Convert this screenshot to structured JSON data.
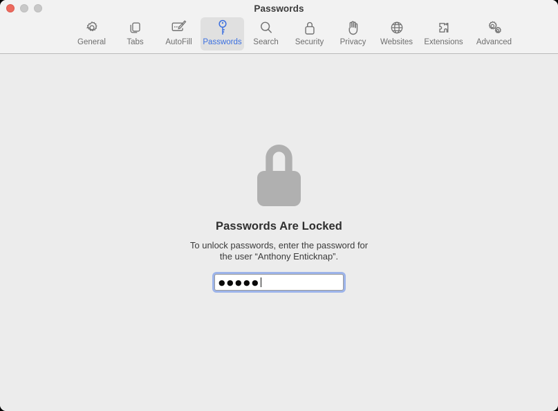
{
  "window": {
    "title": "Passwords",
    "traffic_lights": [
      {
        "name": "close",
        "color": "#ec6a5e"
      },
      {
        "name": "minimize",
        "color": "#c8c8c8"
      },
      {
        "name": "zoom",
        "color": "#c8c8c8"
      }
    ],
    "background": "#ececec",
    "toolbar_background": "#f2f2f2"
  },
  "toolbar": {
    "selected": "Passwords",
    "accent_color": "#3a6fe0",
    "items": [
      {
        "label": "General",
        "icon": "gear-icon",
        "selected": false
      },
      {
        "label": "Tabs",
        "icon": "tabs-icon",
        "selected": false
      },
      {
        "label": "AutoFill",
        "icon": "autofill-icon",
        "selected": false
      },
      {
        "label": "Passwords",
        "icon": "key-icon",
        "selected": true
      },
      {
        "label": "Search",
        "icon": "search-icon",
        "selected": false
      },
      {
        "label": "Security",
        "icon": "lock-icon",
        "selected": false
      },
      {
        "label": "Privacy",
        "icon": "hand-icon",
        "selected": false
      },
      {
        "label": "Websites",
        "icon": "globe-icon",
        "selected": false
      },
      {
        "label": "Extensions",
        "icon": "puzzle-icon",
        "selected": false
      },
      {
        "label": "Advanced",
        "icon": "gears-icon",
        "selected": false
      }
    ]
  },
  "main": {
    "status_icon": "padlock-closed-icon",
    "status_icon_color": "#b0b0b0",
    "title": "Passwords Are Locked",
    "description_line1": "To unlock passwords, enter the password for",
    "description_line2": "the user “Anthony Enticknap”.",
    "password_field": {
      "value": "●●●●●",
      "character_count": 5,
      "placeholder": "",
      "focused": true,
      "focus_ring_color": "#5d86e9"
    }
  }
}
